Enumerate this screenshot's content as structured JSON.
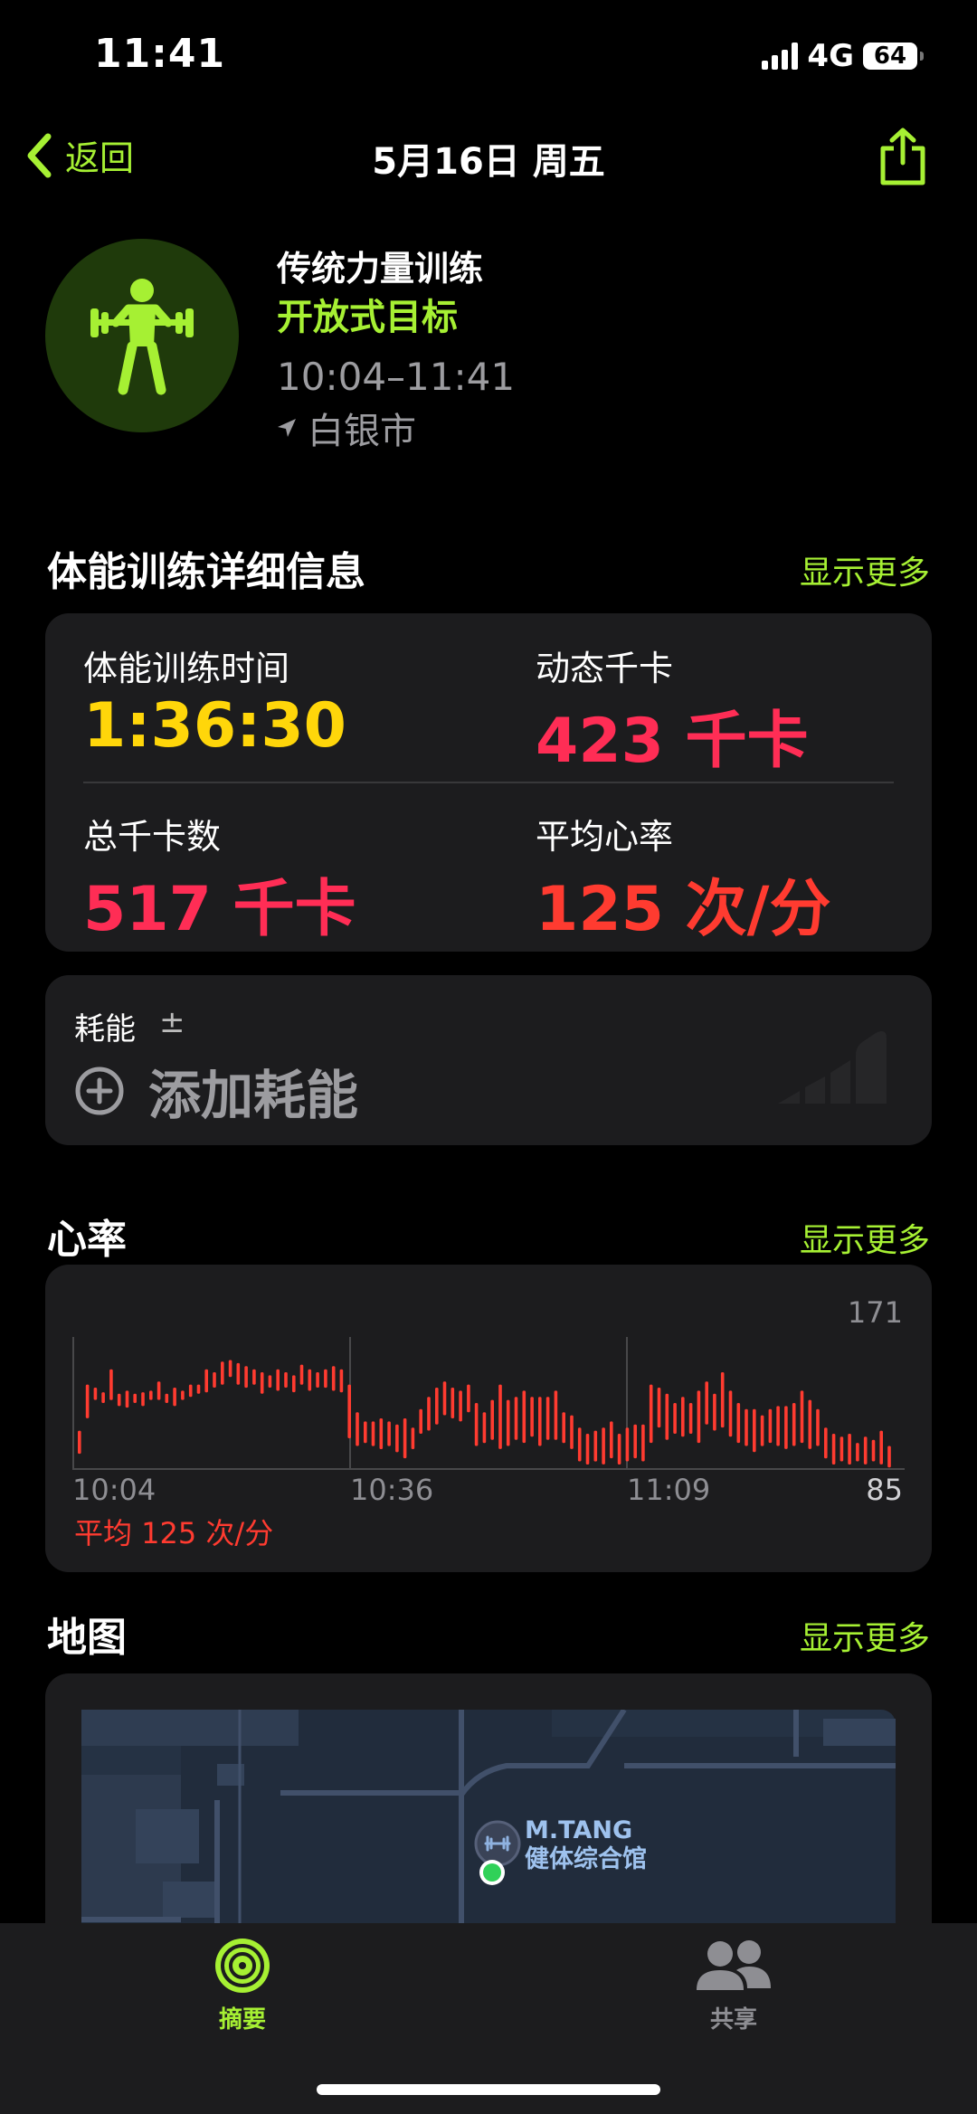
{
  "status_bar": {
    "time": "11:41",
    "network": "4G",
    "battery": "64"
  },
  "nav": {
    "back_label": "返回",
    "title": "5月16日 周五"
  },
  "workout": {
    "name": "传统力量训练",
    "goal": "开放式目标",
    "time_range": "10:04–11:41",
    "location": "白银市"
  },
  "details": {
    "section_title": "体能训练详细信息",
    "show_more": "显示更多",
    "stats": [
      {
        "label": "体能训练时间",
        "value": "1:36:30",
        "color": "#ffd60a"
      },
      {
        "label": "动态千卡",
        "value": "423 千卡",
        "color": "#ff2d55"
      },
      {
        "label": "总千卡数",
        "value": "517 千卡",
        "color": "#ff2d55"
      },
      {
        "label": "平均心率",
        "value": "125 次/分",
        "color": "#ff3b30"
      }
    ]
  },
  "effort": {
    "label": "耗能",
    "pm": "±",
    "add_label": "添加耗能"
  },
  "heart_rate": {
    "section_title": "心率",
    "show_more": "显示更多",
    "max_label": "171",
    "min_label": "85",
    "avg_label": "平均 125 次/分",
    "x_labels": [
      "10:04",
      "10:36",
      "11:09"
    ]
  },
  "chart_data": {
    "type": "bar",
    "title": "",
    "x_tick_labels": [
      "10:04",
      "10:36",
      "11:09"
    ],
    "ylim": [
      85,
      171
    ],
    "color": "#ff3b30",
    "values": [
      [
        95,
        110
      ],
      [
        118,
        140
      ],
      [
        130,
        138
      ],
      [
        128,
        135
      ],
      [
        130,
        150
      ],
      [
        126,
        134
      ],
      [
        125,
        136
      ],
      [
        128,
        134
      ],
      [
        126,
        135
      ],
      [
        130,
        136
      ],
      [
        130,
        142
      ],
      [
        128,
        134
      ],
      [
        126,
        138
      ],
      [
        130,
        136
      ],
      [
        132,
        140
      ],
      [
        134,
        140
      ],
      [
        135,
        150
      ],
      [
        138,
        148
      ],
      [
        140,
        155
      ],
      [
        145,
        156
      ],
      [
        140,
        154
      ],
      [
        138,
        152
      ],
      [
        140,
        150
      ],
      [
        134,
        148
      ],
      [
        138,
        146
      ],
      [
        136,
        150
      ],
      [
        138,
        148
      ],
      [
        135,
        146
      ],
      [
        140,
        153
      ],
      [
        136,
        150
      ],
      [
        138,
        148
      ],
      [
        138,
        150
      ],
      [
        136,
        152
      ],
      [
        135,
        150
      ],
      [
        105,
        140
      ],
      [
        100,
        122
      ],
      [
        102,
        116
      ],
      [
        100,
        116
      ],
      [
        98,
        118
      ],
      [
        100,
        116
      ],
      [
        96,
        114
      ],
      [
        92,
        118
      ],
      [
        98,
        112
      ],
      [
        108,
        124
      ],
      [
        110,
        132
      ],
      [
        114,
        138
      ],
      [
        120,
        142
      ],
      [
        118,
        138
      ],
      [
        116,
        136
      ],
      [
        122,
        140
      ],
      [
        100,
        128
      ],
      [
        102,
        122
      ],
      [
        104,
        130
      ],
      [
        98,
        140
      ],
      [
        100,
        130
      ],
      [
        104,
        132
      ],
      [
        102,
        136
      ],
      [
        106,
        132
      ],
      [
        100,
        132
      ],
      [
        104,
        132
      ],
      [
        104,
        136
      ],
      [
        102,
        122
      ],
      [
        98,
        120
      ],
      [
        90,
        112
      ],
      [
        88,
        108
      ],
      [
        90,
        110
      ],
      [
        88,
        112
      ],
      [
        92,
        116
      ],
      [
        88,
        108
      ],
      [
        90,
        112
      ],
      [
        92,
        114
      ],
      [
        90,
        114
      ],
      [
        102,
        140
      ],
      [
        112,
        138
      ],
      [
        104,
        134
      ],
      [
        108,
        128
      ],
      [
        106,
        132
      ],
      [
        108,
        128
      ],
      [
        102,
        136
      ],
      [
        114,
        142
      ],
      [
        110,
        134
      ],
      [
        112,
        148
      ],
      [
        106,
        136
      ],
      [
        102,
        128
      ],
      [
        100,
        124
      ],
      [
        96,
        124
      ],
      [
        100,
        120
      ],
      [
        102,
        124
      ],
      [
        100,
        126
      ],
      [
        98,
        126
      ],
      [
        100,
        128
      ],
      [
        102,
        136
      ],
      [
        98,
        130
      ],
      [
        100,
        124
      ],
      [
        92,
        112
      ],
      [
        88,
        108
      ],
      [
        90,
        106
      ],
      [
        88,
        108
      ],
      [
        90,
        102
      ],
      [
        88,
        106
      ],
      [
        90,
        104
      ],
      [
        88,
        110
      ],
      [
        86,
        100
      ]
    ]
  },
  "map": {
    "section_title": "地图",
    "show_more": "显示更多",
    "place_name": "M.TANG",
    "place_sub": "健体综合馆"
  },
  "tabs": [
    {
      "label": "摘要",
      "active": true
    },
    {
      "label": "共享",
      "active": false
    }
  ],
  "colors": {
    "accent": "#a6f033",
    "yellow": "#ffd60a",
    "pink": "#ff2d55",
    "red": "#ff3b30"
  }
}
